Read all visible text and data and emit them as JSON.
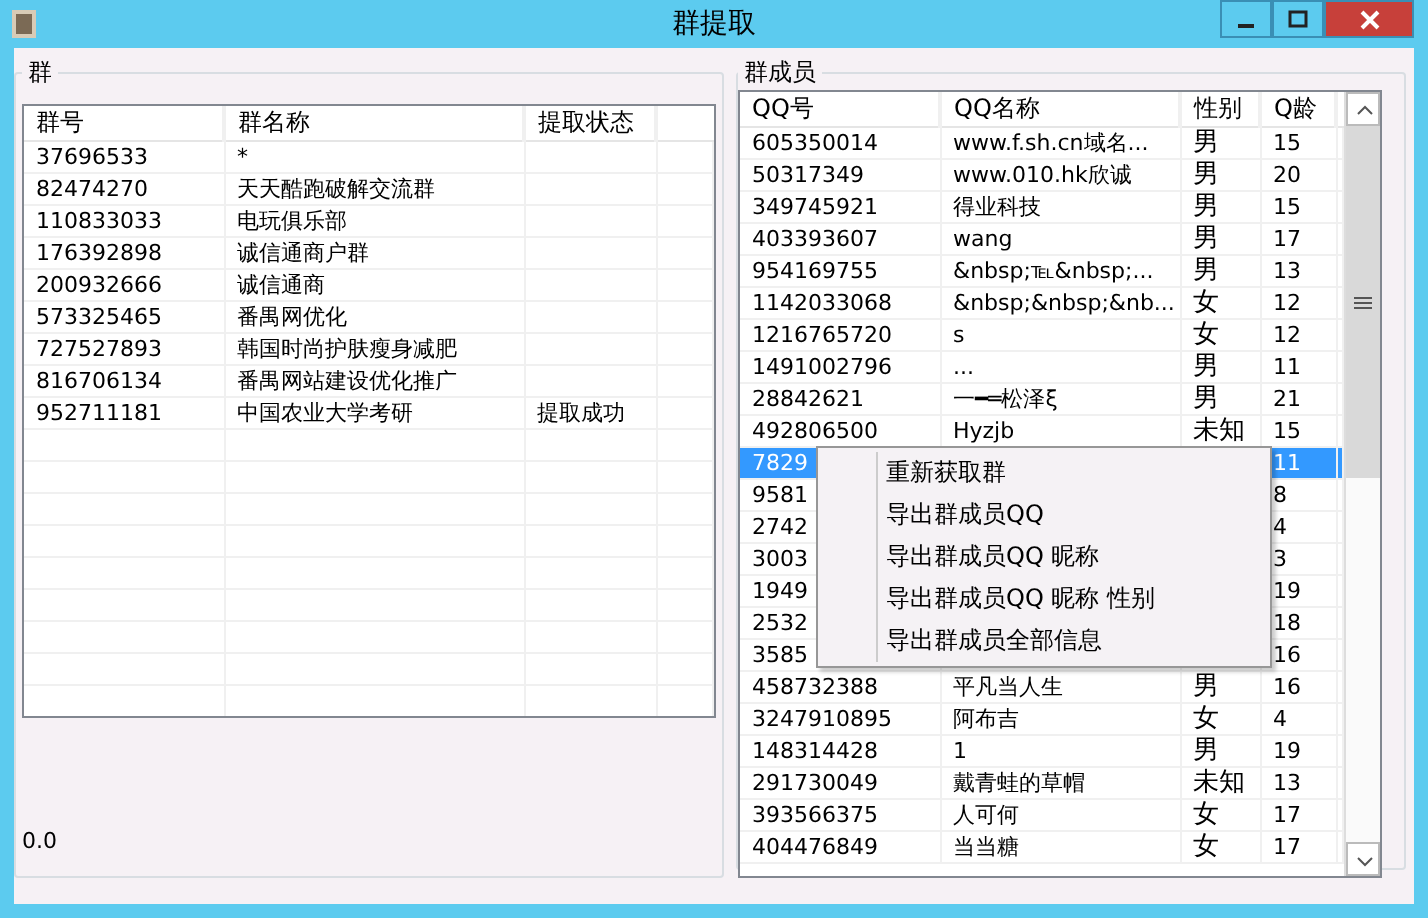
{
  "window": {
    "title": "群提取"
  },
  "groups_panel": {
    "title": "群",
    "columns": [
      "群号",
      "群名称",
      "提取状态"
    ],
    "rows": [
      {
        "id": "37696533",
        "name": "*",
        "status": ""
      },
      {
        "id": "82474270",
        "name": "天天酷跑破解交流群",
        "status": ""
      },
      {
        "id": "110833033",
        "name": "电玩俱乐部",
        "status": ""
      },
      {
        "id": "176392898",
        "name": "诚信通商户群",
        "status": ""
      },
      {
        "id": "200932666",
        "name": "诚信通商",
        "status": ""
      },
      {
        "id": "573325465",
        "name": "番禺网优化",
        "status": ""
      },
      {
        "id": "727527893",
        "name": "韩国时尚护肤瘦身减肥",
        "status": ""
      },
      {
        "id": "816706134",
        "name": "番禺网站建设优化推广",
        "status": ""
      },
      {
        "id": "952711181",
        "name": "中国农业大学考研",
        "status": "提取成功"
      }
    ]
  },
  "progress_text": "0.0",
  "members_panel": {
    "title": "群成员",
    "columns": [
      "QQ号",
      "QQ名称",
      "性别",
      "Q龄"
    ],
    "rows": [
      {
        "qq": "605350014",
        "name": "www.f.sh.cn域名...",
        "gender": "男",
        "age": "15",
        "selected": false
      },
      {
        "qq": "50317349",
        "name": "www.010.hk欣诚",
        "gender": "男",
        "age": "20",
        "selected": false
      },
      {
        "qq": "349745921",
        "name": "得业科技",
        "gender": "男",
        "age": "15",
        "selected": false
      },
      {
        "qq": "403393607",
        "name": "wang",
        "gender": "男",
        "age": "17",
        "selected": false
      },
      {
        "qq": "954169755",
        "name": "&nbsp;℡&nbsp;...",
        "gender": "男",
        "age": "13",
        "selected": false
      },
      {
        "qq": "1142033068",
        "name": "&nbsp;&nbsp;&nb...",
        "gender": "女",
        "age": "12",
        "selected": false
      },
      {
        "qq": "1216765720",
        "name": "s",
        "gender": "女",
        "age": "12",
        "selected": false
      },
      {
        "qq": "1491002796",
        "name": "...",
        "gender": "男",
        "age": "11",
        "selected": false
      },
      {
        "qq": "28842621",
        "name": "一━═松泽ξ",
        "gender": "男",
        "age": "21",
        "selected": false
      },
      {
        "qq": "492806500",
        "name": "Hyzjb",
        "gender": "未知",
        "age": "15",
        "selected": false
      },
      {
        "qq": "7829",
        "name": "",
        "gender": "",
        "age": "11",
        "selected": true
      },
      {
        "qq": "9581",
        "name": "",
        "gender": "",
        "age": "8",
        "selected": false
      },
      {
        "qq": "2742",
        "name": "",
        "gender": "",
        "age": "4",
        "selected": false
      },
      {
        "qq": "3003",
        "name": "",
        "gender": "",
        "age": "3",
        "selected": false
      },
      {
        "qq": "1949",
        "name": "",
        "gender": "",
        "age": "19",
        "selected": false
      },
      {
        "qq": "2532",
        "name": "",
        "gender": "",
        "age": "18",
        "selected": false
      },
      {
        "qq": "3585",
        "name": "",
        "gender": "",
        "age": "16",
        "selected": false
      },
      {
        "qq": "458732388",
        "name": "平凡当人生",
        "gender": "男",
        "age": "16",
        "selected": false
      },
      {
        "qq": "3247910895",
        "name": "阿布吉",
        "gender": "女",
        "age": "4",
        "selected": false
      },
      {
        "qq": "148314428",
        "name": "1",
        "gender": "男",
        "age": "19",
        "selected": false
      },
      {
        "qq": "291730049",
        "name": "戴青蛙的草帽",
        "gender": "未知",
        "age": "13",
        "selected": false
      },
      {
        "qq": "393566375",
        "name": "人可何",
        "gender": "女",
        "age": "17",
        "selected": false
      },
      {
        "qq": "404476849",
        "name": "当当糖",
        "gender": "女",
        "age": "17",
        "selected": false
      }
    ]
  },
  "context_menu": {
    "items": [
      "重新获取群",
      "导出群成员QQ",
      "导出群成员QQ 昵称",
      "导出群成员QQ 昵称 性别",
      "导出群成员全部信息"
    ]
  }
}
